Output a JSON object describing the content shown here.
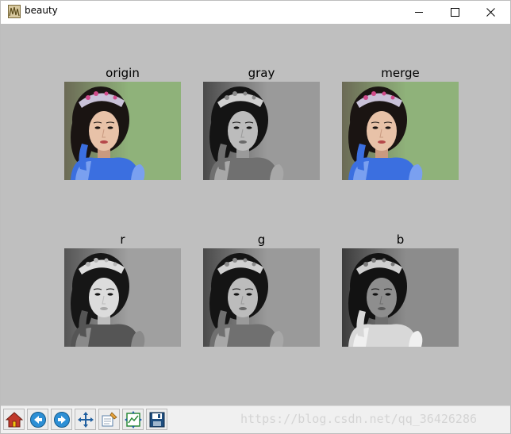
{
  "window": {
    "title": "beauty",
    "controls": [
      "minimize",
      "maximize",
      "close"
    ]
  },
  "subplots": [
    {
      "title": "origin",
      "mode": "color"
    },
    {
      "title": "gray",
      "mode": "gray"
    },
    {
      "title": "merge",
      "mode": "color"
    },
    {
      "title": "r",
      "mode": "gray-light"
    },
    {
      "title": "g",
      "mode": "gray"
    },
    {
      "title": "b",
      "mode": "gray-dark"
    }
  ],
  "toolbar": {
    "buttons": [
      "home-icon",
      "back-icon",
      "forward-icon",
      "pan-icon",
      "zoom-icon",
      "subplots-config-icon",
      "save-icon"
    ]
  },
  "watermark": "https://blog.csdn.net/qq_36426286",
  "colors": {
    "canvas_bg": "#bfbfbf",
    "toolbar_bg": "#f0f0f0",
    "dress_blue": "#3b6fe0",
    "background_green": "#8fb27a"
  }
}
